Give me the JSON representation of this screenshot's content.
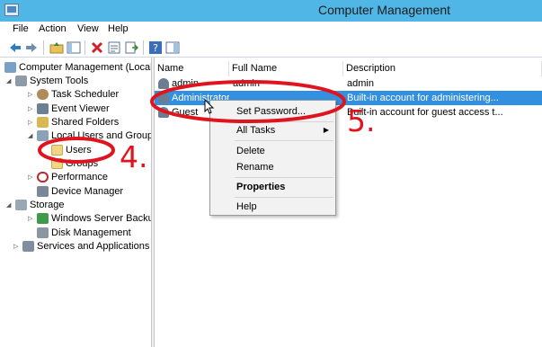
{
  "window": {
    "title": "Computer Management"
  },
  "menubar": {
    "items": [
      "File",
      "Action",
      "View",
      "Help"
    ]
  },
  "toolbar": {
    "icons": [
      "back-arrow-icon",
      "forward-arrow-icon",
      "up-folder-icon",
      "show-hide-tree-icon",
      "delete-icon",
      "properties-icon",
      "export-list-icon",
      "help-icon",
      "action-pane-icon"
    ]
  },
  "tree": {
    "root": "Computer Management (Local",
    "system_tools": "System Tools",
    "task_scheduler": "Task Scheduler",
    "event_viewer": "Event Viewer",
    "shared_folders": "Shared Folders",
    "local_users": "Local Users and Groups",
    "users": "Users",
    "groups": "Groups",
    "performance": "Performance",
    "device_manager": "Device Manager",
    "storage": "Storage",
    "wsb": "Windows Server Backup",
    "disk_mgmt": "Disk Management",
    "services": "Services and Applications"
  },
  "list": {
    "columns": {
      "name": "Name",
      "fullname": "Full Name",
      "description": "Description"
    },
    "rows": [
      {
        "name": "admin",
        "fullname": "admin",
        "description": "admin"
      },
      {
        "name": "Administrator",
        "fullname": "",
        "description": "Built-in account for administering..."
      },
      {
        "name": "Guest",
        "fullname": "",
        "description": "Built-in account for guest access t..."
      }
    ]
  },
  "context_menu": {
    "set_password": "Set Password...",
    "all_tasks": "All Tasks",
    "delete": "Delete",
    "rename": "Rename",
    "properties": "Properties",
    "help": "Help"
  },
  "annotations": {
    "step4": "4.",
    "step5": "5."
  },
  "colors": {
    "titlebar": "#4fb6e6",
    "selection": "#3390e0",
    "annotation": "#e0141e"
  }
}
